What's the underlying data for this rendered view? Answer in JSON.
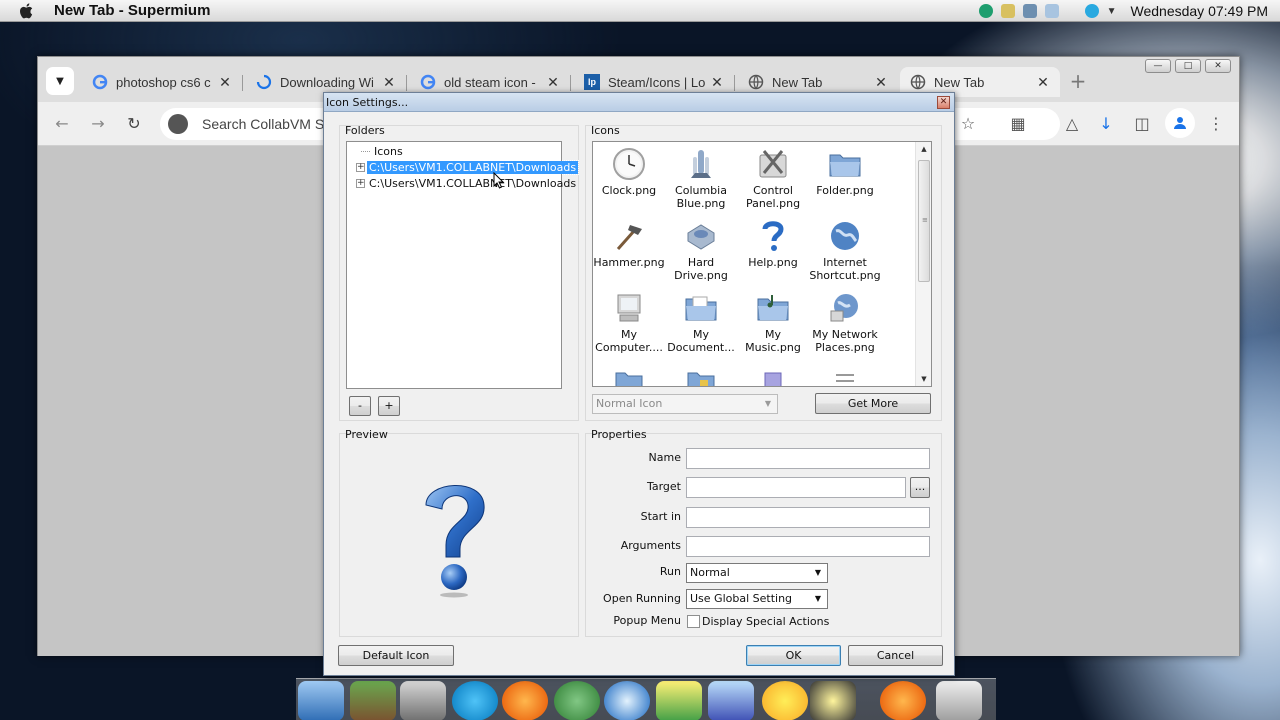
{
  "menubar": {
    "app_title": "New Tab - Supermium",
    "clock": "Wednesday 07:49 PM"
  },
  "browser": {
    "tabs": [
      {
        "label": "photoshop cs6 c",
        "favicon": "google-icon"
      },
      {
        "label": "Downloading Wi",
        "favicon": "loading-icon"
      },
      {
        "label": "old steam icon -",
        "favicon": "google-icon"
      },
      {
        "label": "Steam/Icons | Lo",
        "favicon": "lp-icon"
      },
      {
        "label": "New Tab",
        "favicon": "globe-icon"
      },
      {
        "label": "New Tab",
        "favicon": "globe-icon",
        "active": true
      }
    ],
    "omnibox_text": "Search CollabVM Se"
  },
  "dialog": {
    "title": "Icon Settings...",
    "folders": {
      "label": "Folders",
      "root": "Icons",
      "items": [
        {
          "path": "C:\\Users\\VM1.COLLABNET\\Downloads",
          "selected": true
        },
        {
          "path": "C:\\Users\\VM1.COLLABNET\\Downloads",
          "selected": false
        }
      ],
      "remove_label": "-",
      "add_label": "+"
    },
    "icons": {
      "label": "Icons",
      "items": [
        {
          "name": "Clock.png",
          "icon": "clock-icon"
        },
        {
          "name": "Columbia Blue.png",
          "icon": "shuttle-icon"
        },
        {
          "name": "Control Panel.png",
          "icon": "control-panel-icon"
        },
        {
          "name": "Folder.png",
          "icon": "folder-icon"
        },
        {
          "name": "Hammer.png",
          "icon": "hammer-icon"
        },
        {
          "name": "Hard Drive.png",
          "icon": "hard-drive-icon"
        },
        {
          "name": "Help.png",
          "icon": "help-icon"
        },
        {
          "name": "Internet Shortcut.png",
          "icon": "internet-shortcut-icon"
        },
        {
          "name": "My Computer....",
          "icon": "computer-icon"
        },
        {
          "name": "My Document...",
          "icon": "documents-folder-icon"
        },
        {
          "name": "My Music.png",
          "icon": "music-folder-icon"
        },
        {
          "name": "My Network Places.png",
          "icon": "network-icon"
        }
      ],
      "icon_type": "Normal Icon",
      "get_more_label": "Get More"
    },
    "preview": {
      "label": "Preview",
      "icon": "help-icon"
    },
    "properties": {
      "label": "Properties",
      "name_label": "Name",
      "name_value": "",
      "target_label": "Target",
      "target_value": "",
      "browse_label": "...",
      "start_in_label": "Start in",
      "start_in_value": "",
      "arguments_label": "Arguments",
      "arguments_value": "",
      "run_label": "Run",
      "run_value": "Normal",
      "open_running_label": "Open Running",
      "open_running_value": "Use Global Setting",
      "popup_menu_label": "Popup Menu",
      "display_special_label": "Display Special Actions",
      "display_special_checked": false
    },
    "buttons": {
      "default_icon": "Default Icon",
      "ok": "OK",
      "cancel": "Cancel"
    }
  }
}
